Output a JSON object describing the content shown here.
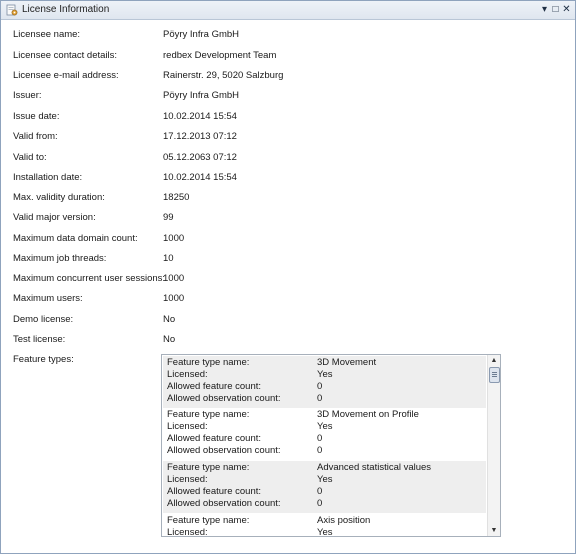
{
  "window": {
    "title": "License Information",
    "icon": "license-gear-icon",
    "buttons": {
      "minimize": "▾",
      "maximize": "□",
      "close": "✕"
    }
  },
  "fields": [
    {
      "label": "Licensee name:",
      "value": "Pöyry Infra GmbH"
    },
    {
      "label": "Licensee contact details:",
      "value": "redbex Development Team"
    },
    {
      "label": "Licensee e-mail address:",
      "value": "Rainerstr. 29, 5020 Salzburg"
    },
    {
      "label": "Issuer:",
      "value": "Pöyry Infra GmbH"
    },
    {
      "label": "Issue date:",
      "value": "10.02.2014 15:54"
    },
    {
      "label": "Valid from:",
      "value": "17.12.2013 07:12"
    },
    {
      "label": "Valid to:",
      "value": "05.12.2063 07:12"
    },
    {
      "label": "Installation date:",
      "value": "10.02.2014 15:54"
    },
    {
      "label": "Max. validity duration:",
      "value": "18250"
    },
    {
      "label": "Valid major version:",
      "value": "99"
    },
    {
      "label": "Maximum data domain count:",
      "value": "1000"
    },
    {
      "label": "Maximum job threads:",
      "value": "10"
    },
    {
      "label": "Maximum concurrent user sessions:",
      "value": "1000"
    },
    {
      "label": "Maximum users:",
      "value": "1000"
    },
    {
      "label": "Demo license:",
      "value": "No"
    },
    {
      "label": "Test license:",
      "value": "No"
    }
  ],
  "feature_types": {
    "label": "Feature types:",
    "keys": {
      "name": "Feature type name:",
      "licensed": "Licensed:",
      "allowed_feature": "Allowed feature count:",
      "allowed_observation": "Allowed observation count:"
    },
    "items": [
      {
        "name": "3D Movement",
        "licensed": "Yes",
        "allowed_feature": "0",
        "allowed_observation": "0"
      },
      {
        "name": "3D Movement on Profile",
        "licensed": "Yes",
        "allowed_feature": "0",
        "allowed_observation": "0"
      },
      {
        "name": "Advanced statistical values",
        "licensed": "Yes",
        "allowed_feature": "0",
        "allowed_observation": "0"
      },
      {
        "name": "Axis position",
        "licensed": "Yes"
      }
    ],
    "scrollbar": {
      "up": "▲",
      "down": "▼"
    }
  }
}
